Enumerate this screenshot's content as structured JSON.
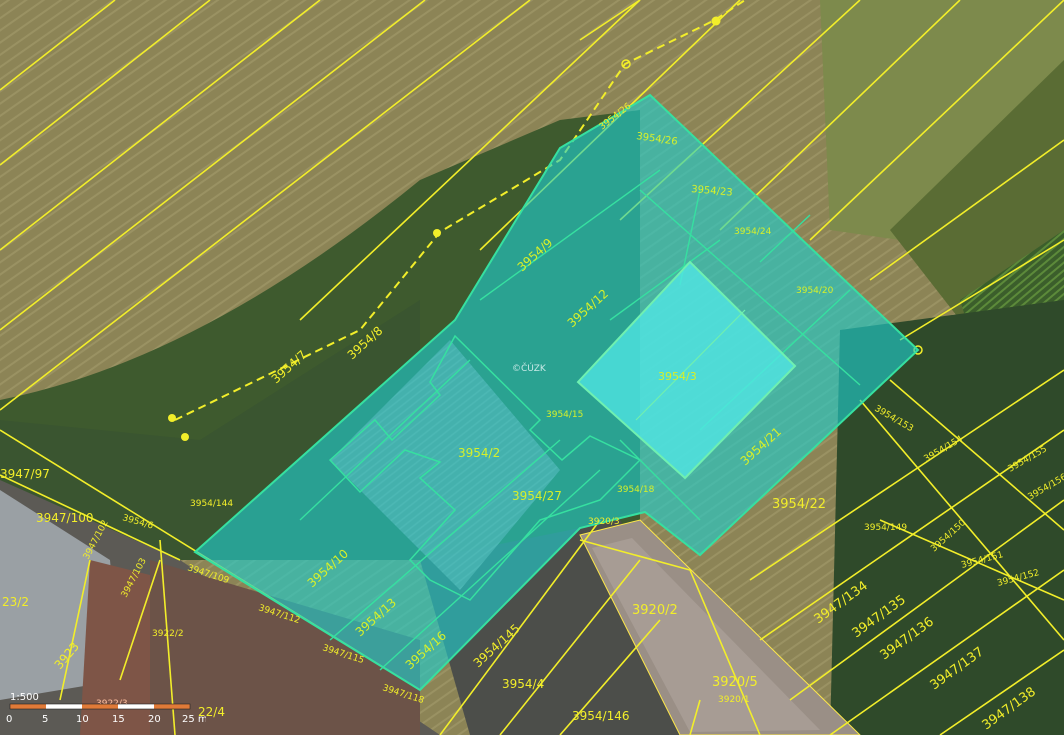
{
  "map": {
    "watermark": "©ČÚZK",
    "colors": {
      "parcel_line": "#f2ee2a",
      "selected_fill": "#1ecfcf",
      "selected_stroke": "#36e0a0",
      "building_fill": "#9a8f86"
    },
    "parcels_selected": [
      "3954/26",
      "3954/23",
      "3954/24",
      "3954/20",
      "3954/9",
      "3954/12",
      "3954/3",
      "3954/15",
      "3954/2",
      "3954/18",
      "3954/27",
      "3954/21",
      "3954/10",
      "3954/13",
      "3954/16"
    ],
    "parcels_other": [
      "3954/26",
      "3954/8",
      "3954/7",
      "3954/144",
      "3954/6",
      "3947/100",
      "3947/97",
      "3947/102",
      "3947/103",
      "3947/109",
      "3947/112",
      "3947/115",
      "3947/118",
      "3922/2",
      "3922/3",
      "3923",
      "23/2",
      "22/4",
      "3920/3",
      "3920/2",
      "3920/5",
      "3920/1",
      "3954/145",
      "3954/4",
      "3954/146",
      "3954/22",
      "3954/149",
      "3954/150",
      "3954/151",
      "3954/152",
      "3954/153",
      "3954/154",
      "3954/155",
      "3954/156",
      "3947/134",
      "3947/135",
      "3947/136",
      "3947/137",
      "3947/138"
    ]
  },
  "scale": {
    "ratio": "1:500",
    "ticks": [
      "0",
      "5",
      "10",
      "15",
      "20",
      "25 m"
    ]
  }
}
